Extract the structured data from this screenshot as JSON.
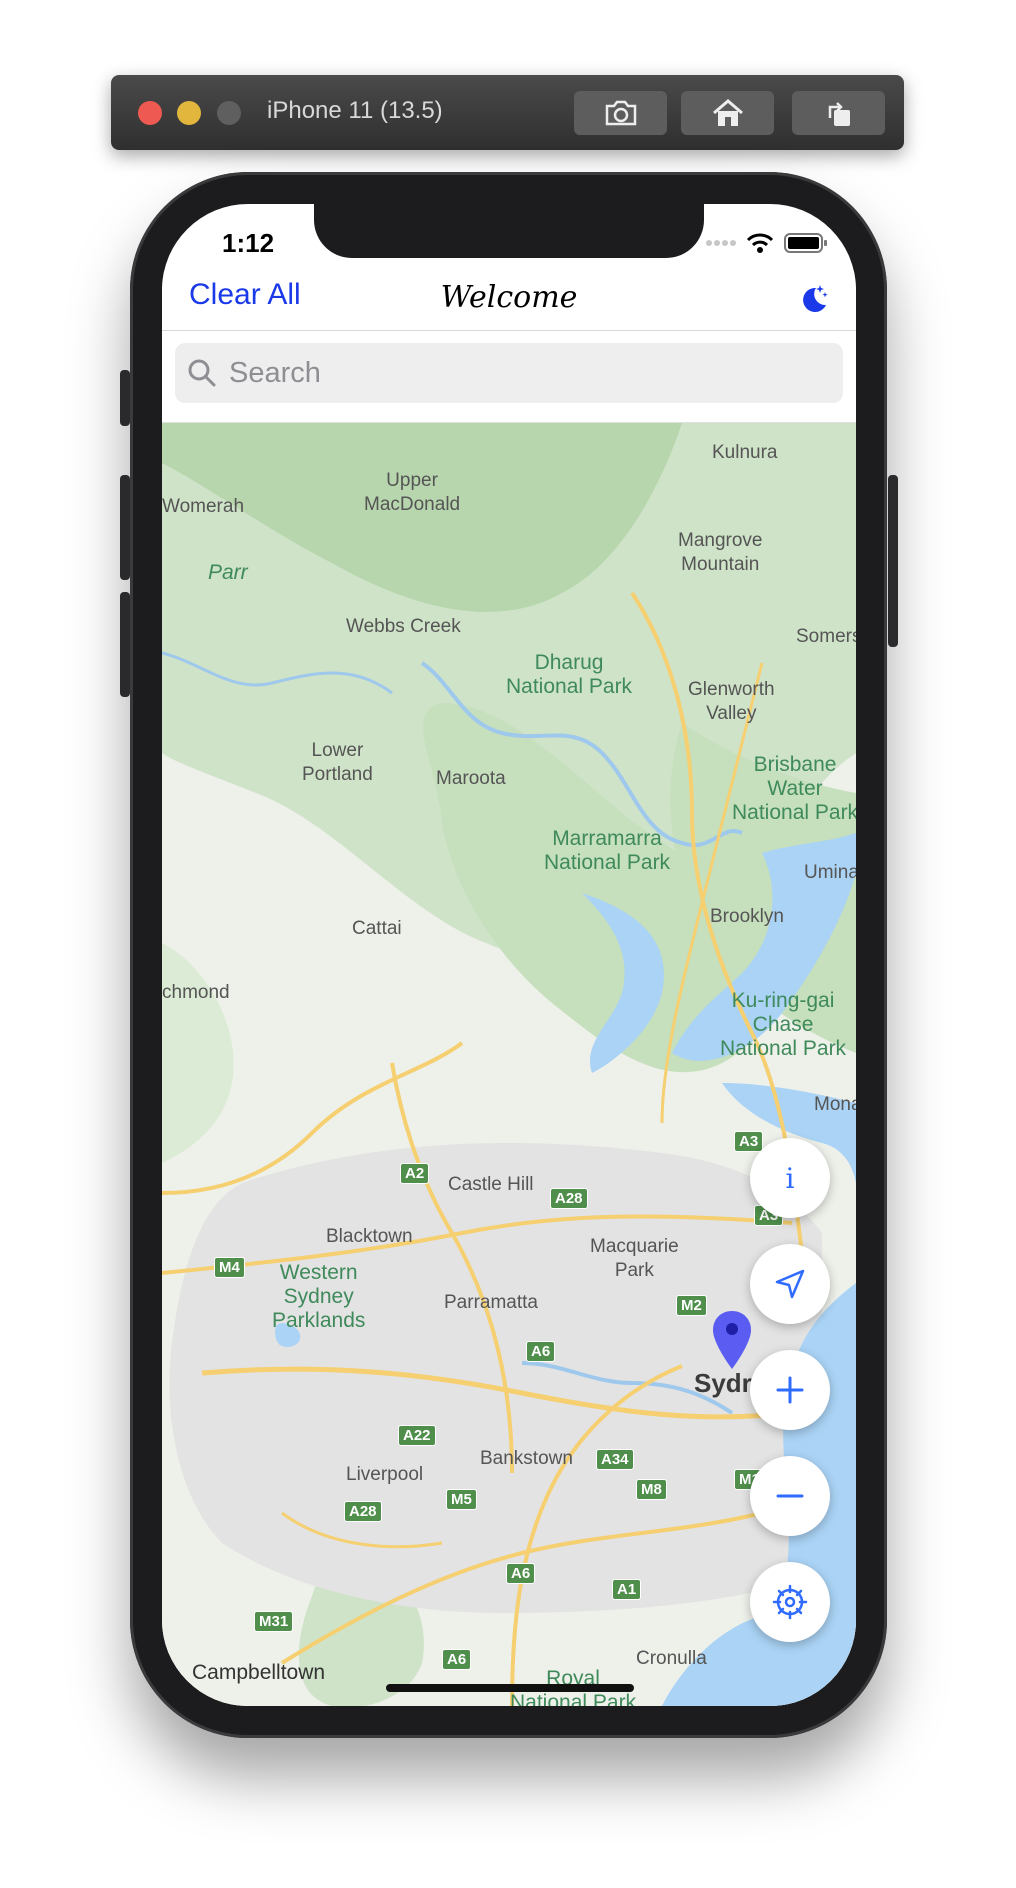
{
  "simulator": {
    "title": "iPhone 11 (13.5)",
    "toolbar": [
      "screenshot-icon",
      "home-icon",
      "rotate-icon"
    ]
  },
  "status_bar": {
    "time": "1:12"
  },
  "nav": {
    "left_button": "Clear All",
    "title": "Welcome",
    "right_icon": "dark-mode-moon-icon"
  },
  "search": {
    "placeholder": "Search",
    "value": ""
  },
  "map": {
    "labels": {
      "kulnura": "Kulnura",
      "upper_macdonald": "Upper\nMacDonald",
      "womerah": "Womerah",
      "parr": "Parr",
      "mangrove_mountain": "Mangrove\nMountain",
      "webbs_creek": "Webbs Creek",
      "somersby": "Somers",
      "dharug": "Dharug\nNational Park",
      "glenworth_valley": "Glenworth\nValley",
      "lower_portland": "Lower\nPortland",
      "maroota": "Maroota",
      "brisbane_water": "Brisbane\nWater\nNational Park",
      "marramarra": "Marramarra\nNational Park",
      "umina": "Umina",
      "brooklyn": "Brooklyn",
      "cattai": "Cattai",
      "richmond": "chmond",
      "kuringgai": "Ku-ring-gai\nChase\nNational Park",
      "mona": "Mona",
      "castle_hill": "Castle Hill",
      "blacktown": "Blacktown",
      "macquarie_park": "Macquarie\nPark",
      "western_sydney": "Western\nSydney\nParklands",
      "parramatta": "Parramatta",
      "sydney": "Sydr",
      "bankstown": "Bankstown",
      "liverpool": "Liverpool",
      "cronulla": "Cronulla",
      "campbelltown": "Campbelltown",
      "royal": "Royal\nNational Park"
    },
    "shields": {
      "a3": "A3",
      "a2": "A2",
      "a28_top": "A28",
      "a3b": "A3",
      "m4": "M4",
      "m2": "M2",
      "a6_top": "A6",
      "a22": "A22",
      "a34": "A34",
      "m8": "M8",
      "m5": "M5",
      "a28_bottom": "A28",
      "a6_mid": "A6",
      "a1": "A1",
      "m31": "M31",
      "a6_bottom": "A6",
      "m1": "M1"
    },
    "pin_color": "#5a5cf2"
  },
  "controls": [
    "info-icon",
    "location-arrow-icon",
    "zoom-in-icon",
    "zoom-out-icon",
    "settings-icon"
  ],
  "colors": {
    "accent": "#1a39e8",
    "fab_icon": "#2f6bff",
    "water": "#aad3f5",
    "park": "#cfe3c8"
  }
}
